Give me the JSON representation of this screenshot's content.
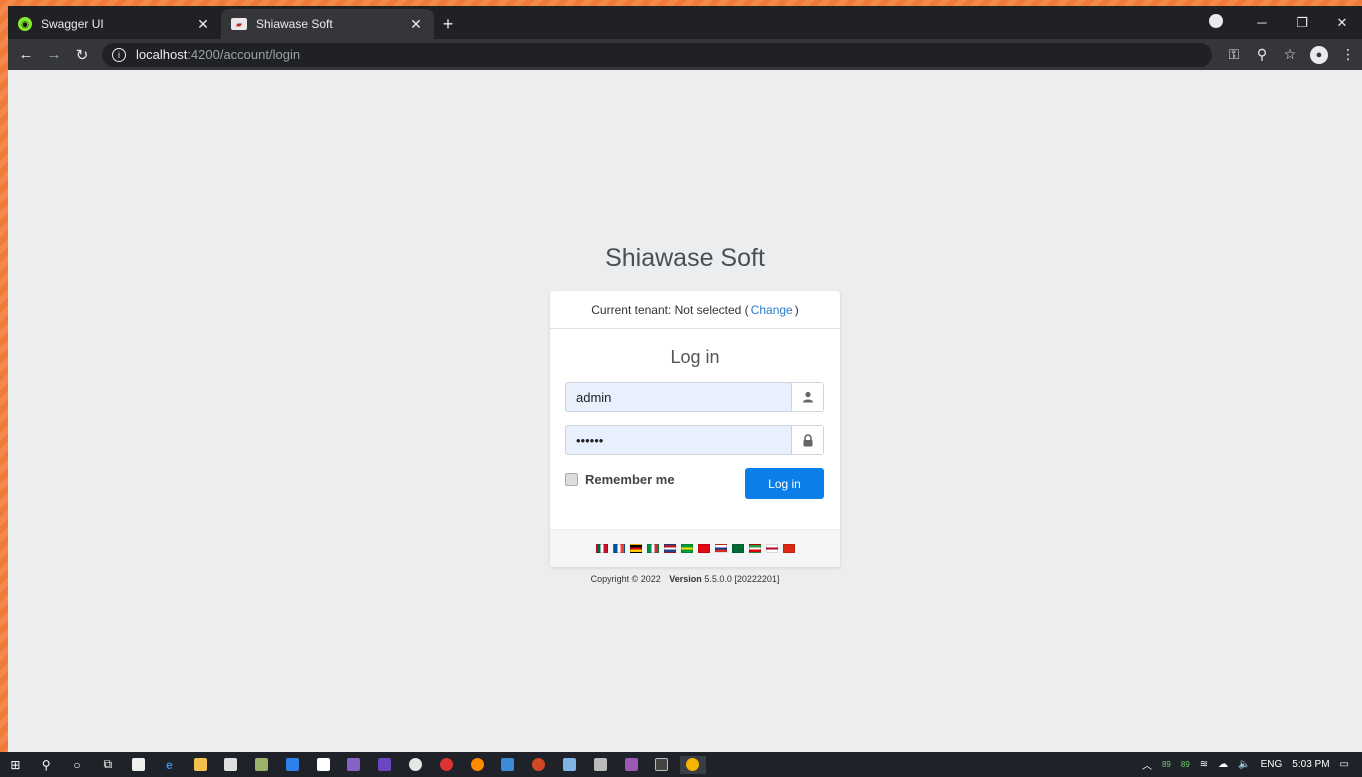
{
  "browser": {
    "tabs": [
      {
        "title": "Swagger UI",
        "favicon": "swagger-icon",
        "active": false
      },
      {
        "title": "Shiawase Soft",
        "favicon": "app-icon",
        "active": true
      }
    ],
    "new_tab": "+",
    "url_host": "localhost",
    "url_path": ":4200/account/login"
  },
  "page": {
    "app_title": "Shiawase Soft",
    "tenant_prefix": "Current tenant: Not selected (",
    "tenant_change": "Change",
    "tenant_suffix": ")",
    "login_title": "Log in",
    "username_value": "admin",
    "password_value": "••••••",
    "remember_label": "Remember me",
    "login_button": "Log in",
    "languages": [
      {
        "code": "es-MX",
        "colors": [
          "#006847",
          "#ffffff",
          "#ce1126"
        ]
      },
      {
        "code": "fr",
        "colors": [
          "#0055a4",
          "#ffffff",
          "#ef4135"
        ]
      },
      {
        "code": "de",
        "colors": [
          "#000000",
          "#dd0000",
          "#ffce00"
        ]
      },
      {
        "code": "it",
        "colors": [
          "#009246",
          "#ffffff",
          "#ce2b37"
        ]
      },
      {
        "code": "nl",
        "colors": [
          "#ae1c28",
          "#ffffff",
          "#21468b"
        ]
      },
      {
        "code": "pt-BR",
        "colors": [
          "#009c3b",
          "#ffdf00",
          "#009c3b"
        ]
      },
      {
        "code": "tr",
        "colors": [
          "#e30a17",
          "#e30a17",
          "#e30a17"
        ]
      },
      {
        "code": "ru",
        "colors": [
          "#ffffff",
          "#0039a6",
          "#d52b1e"
        ]
      },
      {
        "code": "ar",
        "colors": [
          "#006c35",
          "#006c35",
          "#006c35"
        ]
      },
      {
        "code": "fa",
        "colors": [
          "#239f40",
          "#ffffff",
          "#da0000"
        ]
      },
      {
        "code": "ja",
        "colors": [
          "#ffffff",
          "#bc002d",
          "#ffffff"
        ]
      },
      {
        "code": "zh",
        "colors": [
          "#de2910",
          "#de2910",
          "#de2910"
        ]
      }
    ],
    "copyright": "Copyright © 2022",
    "version_label": "Version",
    "version_value": "5.5.0.0 [20222201]"
  },
  "taskbar": {
    "tray_time": "5:03 PM",
    "tray_lang": "ENG",
    "tray_temp1": "89",
    "tray_temp2": "89"
  }
}
